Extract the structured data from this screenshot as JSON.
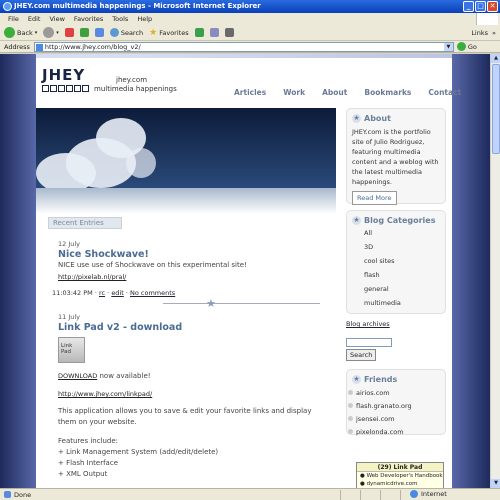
{
  "window": {
    "title": "JHEY.com multimedia happenings - Microsoft Internet Explorer",
    "min": "_",
    "max": "□",
    "close": "✕"
  },
  "menubar": [
    "File",
    "Edit",
    "View",
    "Favorites",
    "Tools",
    "Help"
  ],
  "toolbar": {
    "back": "Back",
    "search": "Search",
    "favorites": "Favorites",
    "links": "Links",
    "links_arrow": "»"
  },
  "addressbar": {
    "label": "Address",
    "url": "http://www.jhey.com/blog_v2/",
    "go": "Go"
  },
  "site": {
    "logo": "JHEY",
    "name": "jhey.com",
    "tagline": "multimedia happenings",
    "nav": [
      "Articles",
      "Work",
      "About",
      "Bookmarks",
      "Contact"
    ]
  },
  "recent_tab": "Recent Entries",
  "posts": [
    {
      "date": "12 July",
      "title": "Nice Shockwave!",
      "text": "NICE use use of Shockwave on this experimental site!",
      "link": "http://pixelab.nl/pral/",
      "meta_time": "11:03:42 PM",
      "meta_links": [
        "rc",
        "edit",
        "No comments"
      ]
    },
    {
      "date": "11 July",
      "title": "Link Pad v2 - download",
      "thumb_label": "Link Pad",
      "download_word": "DOWNLOAD",
      "download_rest": " now available!",
      "link": "http://www.jhey.com/linkpad/",
      "desc": "This application allows you to save & edit your favorite links and display them on your website.",
      "features_title": "Features include:",
      "features": [
        "+ Link Management System (add/edit/delete)",
        "+ Flash Interface",
        "+ XML Output"
      ]
    }
  ],
  "sidebar": {
    "about": {
      "heading": "About",
      "text": "JHEY.com is the portfolio site of Julio Rodriguez, featuring multimedia content and a weblog with the latest multimedia happenings.",
      "button": "Read More"
    },
    "categories": {
      "heading": "Blog Categories",
      "items": [
        "All",
        "3D",
        "cool sites",
        "flash",
        "general",
        "multimedia"
      ]
    },
    "archives": "Blog archives",
    "search_button": "Search",
    "friends": {
      "heading": "Friends",
      "items": [
        "airios.com",
        "flash.granato.org",
        "jsensei.com",
        "pixelonda.com"
      ]
    },
    "linkpad": {
      "title": "(29) Link Pad",
      "items": [
        "Web Developer's Handbook",
        "dynamicdrive.com"
      ]
    }
  },
  "status": {
    "left": "Done",
    "zone": "Internet"
  }
}
